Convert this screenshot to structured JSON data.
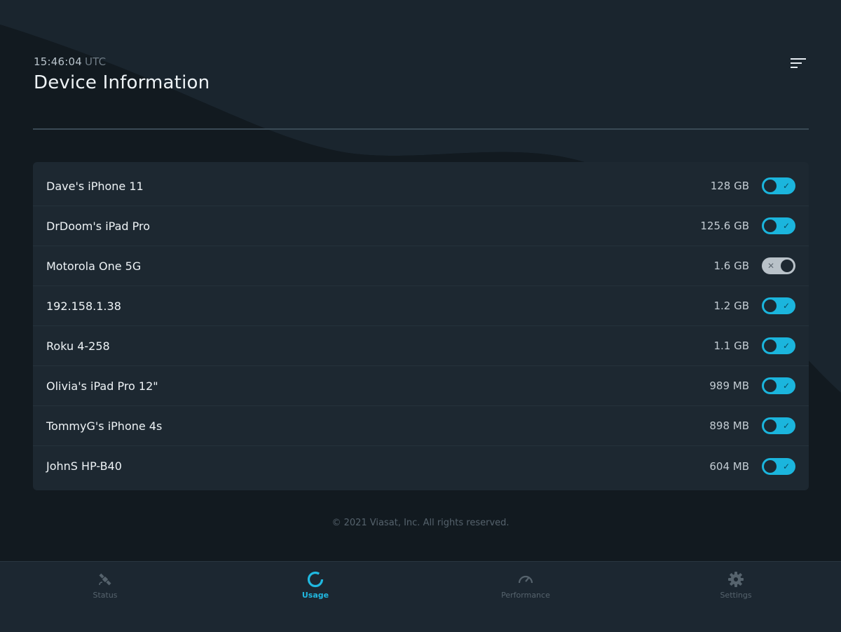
{
  "header": {
    "time": "15:46:04",
    "timezone": "UTC",
    "title": "Device Information"
  },
  "devices": [
    {
      "name": "Dave's iPhone 11",
      "usage": "128 GB",
      "enabled": true
    },
    {
      "name": "DrDoom's iPad Pro",
      "usage": "125.6 GB",
      "enabled": true
    },
    {
      "name": "Motorola One 5G",
      "usage": "1.6 GB",
      "enabled": false
    },
    {
      "name": "192.158.1.38",
      "usage": "1.2 GB",
      "enabled": true
    },
    {
      "name": "Roku 4-258",
      "usage": "1.1 GB",
      "enabled": true
    },
    {
      "name": "Olivia's iPad Pro 12\"",
      "usage": "989 MB",
      "enabled": true
    },
    {
      "name": "TommyG's iPhone 4s",
      "usage": "898 MB",
      "enabled": true
    },
    {
      "name": "JohnS HP-B40",
      "usage": "604 MB",
      "enabled": true
    }
  ],
  "footer": {
    "copyright": "© 2021 Viasat, Inc. All rights reserved."
  },
  "tabs": [
    {
      "label": "Status",
      "icon": "satellite-icon",
      "active": false
    },
    {
      "label": "Usage",
      "icon": "usage-ring-icon",
      "active": true
    },
    {
      "label": "Performance",
      "icon": "speedometer-icon",
      "active": false
    },
    {
      "label": "Settings",
      "icon": "gear-icon",
      "active": false
    }
  ],
  "colors": {
    "accent": "#1bb5dd",
    "background": "#0f171d",
    "card": "#1d2831"
  }
}
